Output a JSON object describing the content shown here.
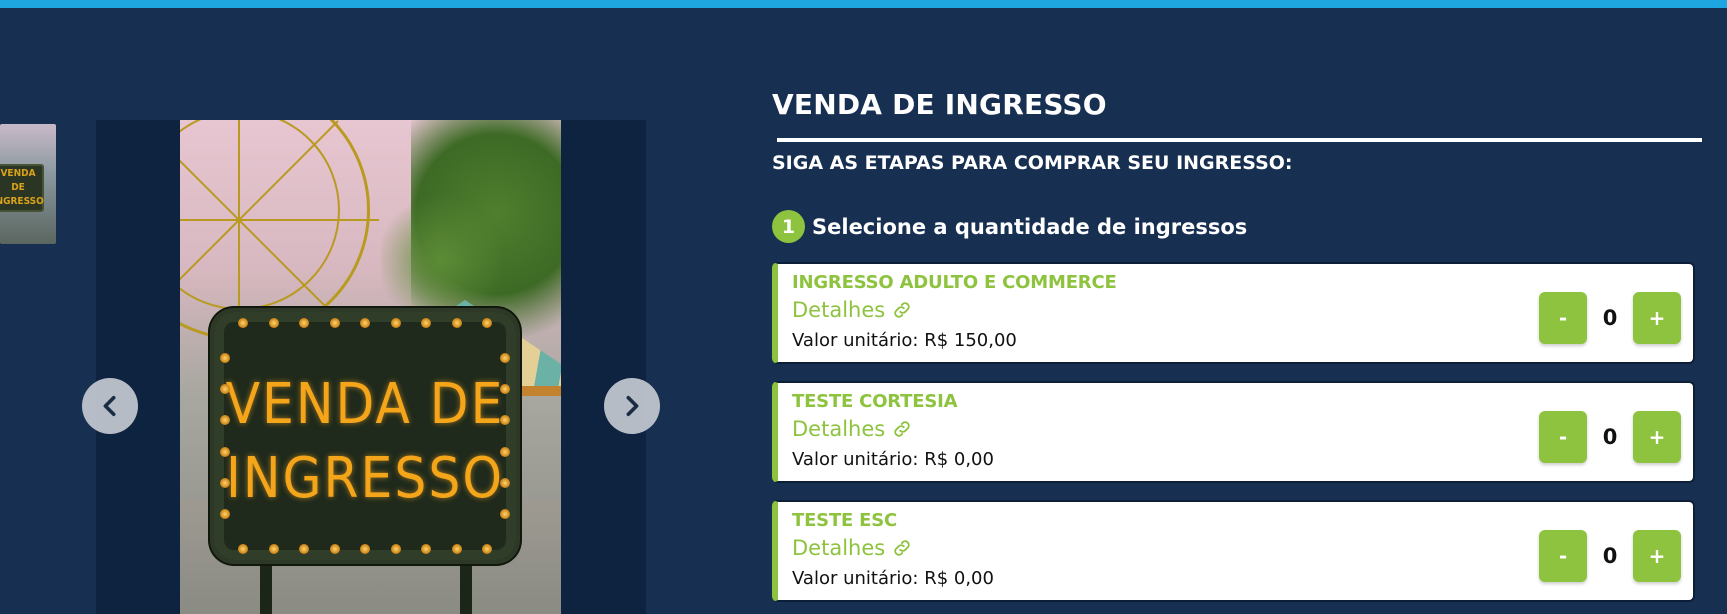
{
  "colors": {
    "background": "#172f50",
    "top_bar": "#1ea6e0",
    "accent_green": "#8dc33e",
    "card_bg": "#ffffff"
  },
  "gallery": {
    "thumbnail_text": "VENDA DE\nINGRESSO",
    "main_image_text": "VENDA DE\nINGRESSO",
    "prev_icon": "chevron-left-icon",
    "next_icon": "chevron-right-icon"
  },
  "panel": {
    "title": "VENDA DE INGRESSO",
    "subtitle": "SIGA AS ETAPAS PARA COMPRAR SEU INGRESSO:",
    "step": {
      "number": "1",
      "label": "Selecione a quantidade de ingressos"
    },
    "tickets": [
      {
        "name": "INGRESSO ADULTO E COMMERCE",
        "details_label": "Detalhes",
        "price": "Valor unitário: R$ 150,00",
        "quantity": "0",
        "minus_label": "-",
        "plus_label": "+"
      },
      {
        "name": "TESTE CORTESIA",
        "details_label": "Detalhes",
        "price": "Valor unitário: R$ 0,00",
        "quantity": "0",
        "minus_label": "-",
        "plus_label": "+"
      },
      {
        "name": "TESTE ESC",
        "details_label": "Detalhes",
        "price": "Valor unitário: R$ 0,00",
        "quantity": "0",
        "minus_label": "-",
        "plus_label": "+"
      }
    ]
  }
}
